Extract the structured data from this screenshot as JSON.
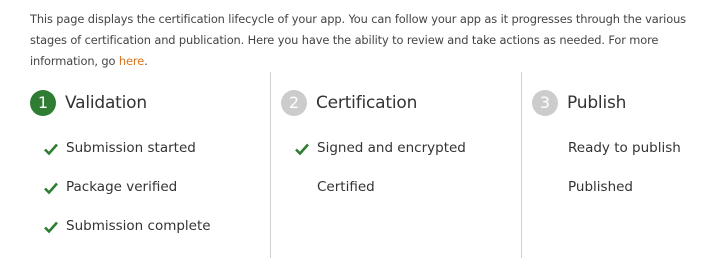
{
  "intro": {
    "text": "This page displays the certification lifecycle of your app. You can follow your app as it progresses through the various stages of certification and publication. Here you have the ability to review and take actions as needed. For more information, go ",
    "link": "here",
    "end": "."
  },
  "colors": {
    "accent_green": "#2f7d32",
    "inactive_gray": "#cccccc",
    "link_orange": "#d9731d"
  },
  "stages": [
    {
      "number": "1",
      "title": "Validation",
      "state": "active",
      "steps": [
        {
          "label": "Submission started",
          "done": true
        },
        {
          "label": "Package verified",
          "done": true
        },
        {
          "label": "Submission complete",
          "done": true
        }
      ]
    },
    {
      "number": "2",
      "title": "Certification",
      "state": "inactive",
      "steps": [
        {
          "label": "Signed and encrypted",
          "done": true
        },
        {
          "label": "Certified",
          "done": false
        }
      ]
    },
    {
      "number": "3",
      "title": "Publish",
      "state": "inactive",
      "steps": [
        {
          "label": "Ready to publish",
          "done": false
        },
        {
          "label": "Published",
          "done": false
        }
      ]
    }
  ]
}
